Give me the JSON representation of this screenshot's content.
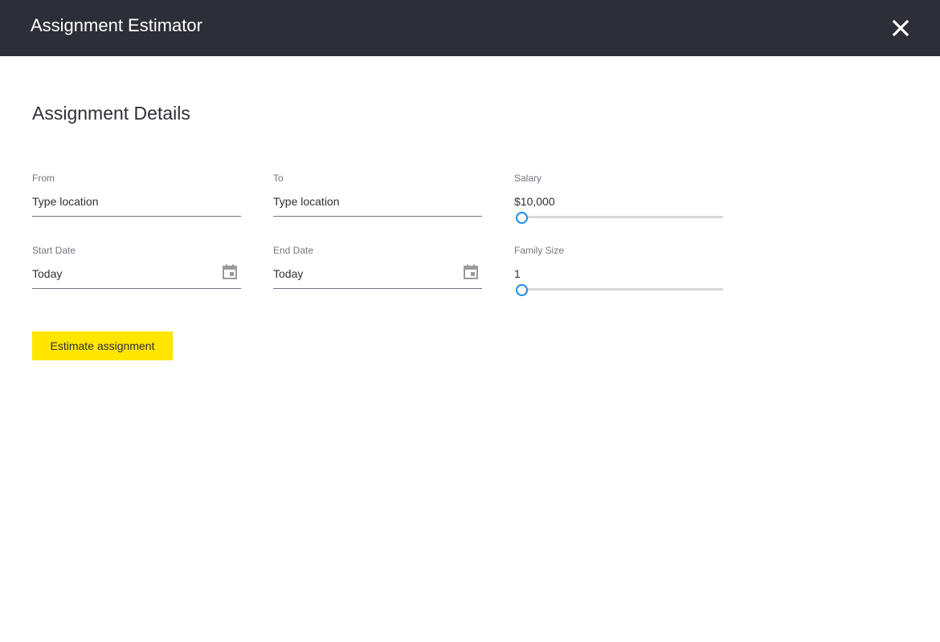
{
  "header": {
    "title": "Assignment Estimator",
    "close_icon": "close-icon"
  },
  "section_title": "Assignment Details",
  "fields": {
    "from": {
      "label": "From",
      "placeholder": "Type location"
    },
    "to": {
      "label": "To",
      "placeholder": "Type location"
    },
    "salary": {
      "label": "Salary",
      "value": "$10,000",
      "slider_fraction": 0
    },
    "start_date": {
      "label": "Start Date",
      "value": "Today",
      "icon": "calendar-icon"
    },
    "end_date": {
      "label": "End Date",
      "value": "Today",
      "icon": "calendar-icon"
    },
    "family_size": {
      "label": "Family Size",
      "value": "1",
      "slider_fraction": 0
    }
  },
  "estimate_button": {
    "label": "Estimate assignment"
  },
  "colors": {
    "header_bg": "#2e2e38",
    "accent": "#ffe600",
    "slider": "#188ce5"
  }
}
